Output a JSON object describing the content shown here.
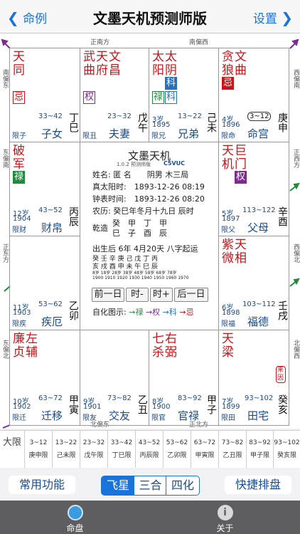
{
  "nav": {
    "back": "命例",
    "title": "文墨天机预测师版",
    "settings": "设置"
  },
  "directions": {
    "top_left": "正南方",
    "top_right": "南偏西",
    "bottom_left": "北偏东",
    "bottom_right": "正北方",
    "left_top": "南偏东",
    "left_mid": "东偏南",
    "left_mid2": "正东方",
    "left_bottom": "东偏北",
    "right_top": "西偏南",
    "right_mid": "正西方",
    "right_mid2": "西偏北",
    "right_bottom": "北偏西"
  },
  "palaces": {
    "si": {
      "stars": [
        "天同"
      ],
      "mutagen": "忌",
      "mutagen_style": "outline",
      "range": "33~42",
      "age": "",
      "year": "",
      "xian": "限子",
      "name": "子女",
      "stem": "丁巳"
    },
    "wu": {
      "stars": [
        "武曲",
        "天府",
        "文昌"
      ],
      "mutagen": "权",
      "mutagen_style": "outline",
      "range": "23~32",
      "age": "",
      "year": "",
      "xian": "限丑",
      "name": "夫妻",
      "stem": "戊午"
    },
    "wei": {
      "stars": [
        "太阳",
        "太阴"
      ],
      "mutagen": "禄",
      "mutagen2": "科",
      "mutagen3": "科",
      "range": "13~22",
      "age": "3岁",
      "year": "1895",
      "xian": "限兄",
      "name": "兄弟",
      "stem": "己未"
    },
    "shen": {
      "stars": [
        "贪狼",
        "文曲"
      ],
      "mutagen": "忌",
      "range": "3~12",
      "age": "4岁",
      "year": "1896",
      "xian": "限命",
      "name": "命宫",
      "stem": "庚申"
    },
    "chen": {
      "stars": [
        "破军"
      ],
      "mutagen": "禄",
      "range": "43~52",
      "age": "12岁",
      "year": "1904",
      "xian": "限财",
      "name": "财帛",
      "stem": "丙辰"
    },
    "you": {
      "stars": [
        "天机",
        "巨门"
      ],
      "mutagen": "权",
      "range": "113~122",
      "age": "5岁",
      "year": "1897",
      "xian": "限父",
      "name": "父母",
      "stem": "辛酉"
    },
    "mao": {
      "stars": [],
      "range": "53~62",
      "age": "11岁",
      "year": "1903",
      "xian": "限疾",
      "name": "疾厄",
      "stem": "乙卯"
    },
    "xu": {
      "stars": [
        "紫微",
        "天相"
      ],
      "range": "103~112",
      "age": "6岁",
      "year": "1898",
      "xian": "限福",
      "name": "福德",
      "stem": "壬戌"
    },
    "yin": {
      "stars": [
        "廉贞",
        "左辅"
      ],
      "range": "63~72",
      "age": "10岁",
      "year": "1902",
      "xian": "限迁",
      "name": "迁移",
      "stem": "甲寅"
    },
    "chou": {
      "stars": [],
      "range": "73~82",
      "age": "9岁",
      "year": "1901",
      "xian": "限友",
      "name": "交友",
      "stem": "乙丑"
    },
    "zi": {
      "stars": [
        "七杀",
        "右弼"
      ],
      "range": "83~92",
      "age": "8岁",
      "year": "1900",
      "xian": "限官",
      "name": "官禄",
      "stem": "甲子"
    },
    "hai": {
      "stars": [
        "天梁"
      ],
      "mutagen": "来因",
      "range": "93~102",
      "age": "7岁",
      "year": "1899",
      "xian": "限田",
      "name": "田宅",
      "stem": "癸亥"
    }
  },
  "center": {
    "title": "文墨天机",
    "version": "1.0.2 预测师版",
    "code": "C5VUC",
    "name_line": "姓名: 匿 名　　阴男 木三局",
    "solar_line": "真太阳时:　1893-12-26 08:19",
    "clock_line": "钟表时间:　1893-12-26 08:20",
    "lunar_line": "农历: 癸巳年冬月十九日 辰时",
    "bazi_label": "乾造",
    "bazi_top": "癸　甲　丁　甲",
    "bazi_bottom": "巳　子　酉　辰",
    "luck_line": "出生后 6年 4月20天 八字起运",
    "luck_stems": "癸 壬 辛 庚 己 戊 丁 丙",
    "luck_branches": "亥 戌 酉 申 未 午 巳 辰",
    "luck_ages": "8岁 18岁 28岁 38岁 48岁 58岁 68岁 78岁",
    "luck_years": "1900 1910 1920 1930 1940 1950 1960 1970",
    "buttons": [
      "前一日",
      "时-",
      "时+",
      "后一日"
    ],
    "legend_label": "自化图示:",
    "legend": [
      "禄",
      "权",
      "科",
      "忌"
    ]
  },
  "daxian": {
    "label": "大限",
    "cells": [
      {
        "range": "3~12",
        "name": "庚申限"
      },
      {
        "range": "13~22",
        "name": "己未限"
      },
      {
        "range": "23~32",
        "name": "戊午限"
      },
      {
        "range": "33~42",
        "name": "丁巳限"
      },
      {
        "range": "43~52",
        "name": "丙辰限"
      },
      {
        "range": "53~62",
        "name": "乙卯限"
      },
      {
        "range": "63~72",
        "name": "甲寅限"
      },
      {
        "range": "73~82",
        "name": "乙丑限"
      },
      {
        "range": "83~92",
        "name": "甲子限"
      },
      {
        "range": "93~102",
        "name": "癸亥限"
      }
    ]
  },
  "toolbar": {
    "common": "常用功能",
    "seg": [
      "飞星",
      "三合",
      "四化"
    ],
    "quick": "快捷排盘"
  },
  "tabs": {
    "chart": "命盘",
    "about": "关于"
  }
}
